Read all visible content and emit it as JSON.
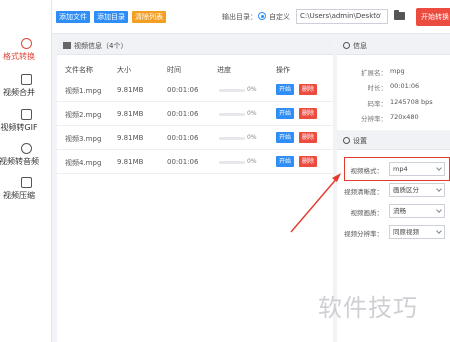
{
  "sidebar": {
    "items": [
      {
        "label": "格式转换",
        "icon": "convert-icon",
        "active": true
      },
      {
        "label": "视频合并",
        "icon": "merge-icon",
        "active": false
      },
      {
        "label": "视频转GIF",
        "icon": "gif-icon",
        "active": false
      },
      {
        "label": "视频转音频",
        "icon": "audio-icon",
        "active": false
      },
      {
        "label": "视频压缩",
        "icon": "compress-icon",
        "active": false
      }
    ]
  },
  "toolbar": {
    "add_file": "添加文件",
    "add_folder": "添加目录",
    "clear_list": "清除列表",
    "output_label": "输出目录：",
    "radio_label": "自定义",
    "output_path": "C:\\Users\\admin\\Deskto",
    "path_more": "···",
    "start_convert": "开始转换"
  },
  "video_list": {
    "title": "视频信息（4个）",
    "headers": {
      "name": "文件名称",
      "size": "大小",
      "duration": "时间",
      "progress": "进度",
      "action": "操作"
    },
    "rows": [
      {
        "name": "视频1.mpg",
        "size": "9.81MB",
        "duration": "00:01:06",
        "progress_pct": 0,
        "progress_text": "0%",
        "start": "开始",
        "delete": "删除"
      },
      {
        "name": "视频2.mpg",
        "size": "9.81MB",
        "duration": "00:01:06",
        "progress_pct": 0,
        "progress_text": "0%",
        "start": "开始",
        "delete": "删除"
      },
      {
        "name": "视频3.mpg",
        "size": "9.81MB",
        "duration": "00:01:06",
        "progress_pct": 0,
        "progress_text": "0%",
        "start": "开始",
        "delete": "删除"
      },
      {
        "name": "视频4.mpg",
        "size": "9.81MB",
        "duration": "00:01:06",
        "progress_pct": 0,
        "progress_text": "0%",
        "start": "开始",
        "delete": "删除"
      }
    ]
  },
  "info": {
    "title": "信息",
    "items": [
      {
        "key": "扩展名：",
        "value": "mpg"
      },
      {
        "key": "时长：",
        "value": "00:01:06"
      },
      {
        "key": "码率：",
        "value": "1245708 bps"
      },
      {
        "key": "分辨率：",
        "value": "720x480"
      }
    ]
  },
  "settings": {
    "title": "设置",
    "fields": [
      {
        "label": "视频格式：",
        "value": "mp4"
      },
      {
        "label": "视频清晰度：",
        "value": "画质区分"
      },
      {
        "label": "视频画质：",
        "value": "流畅"
      },
      {
        "label": "视频分辨率：",
        "value": "同原视频"
      }
    ]
  },
  "watermark": "软件技巧",
  "colors": {
    "accent": "#2f8ef5",
    "danger": "#ec4b3f",
    "warning": "#f3a022",
    "highlight": "#e33a2f"
  }
}
